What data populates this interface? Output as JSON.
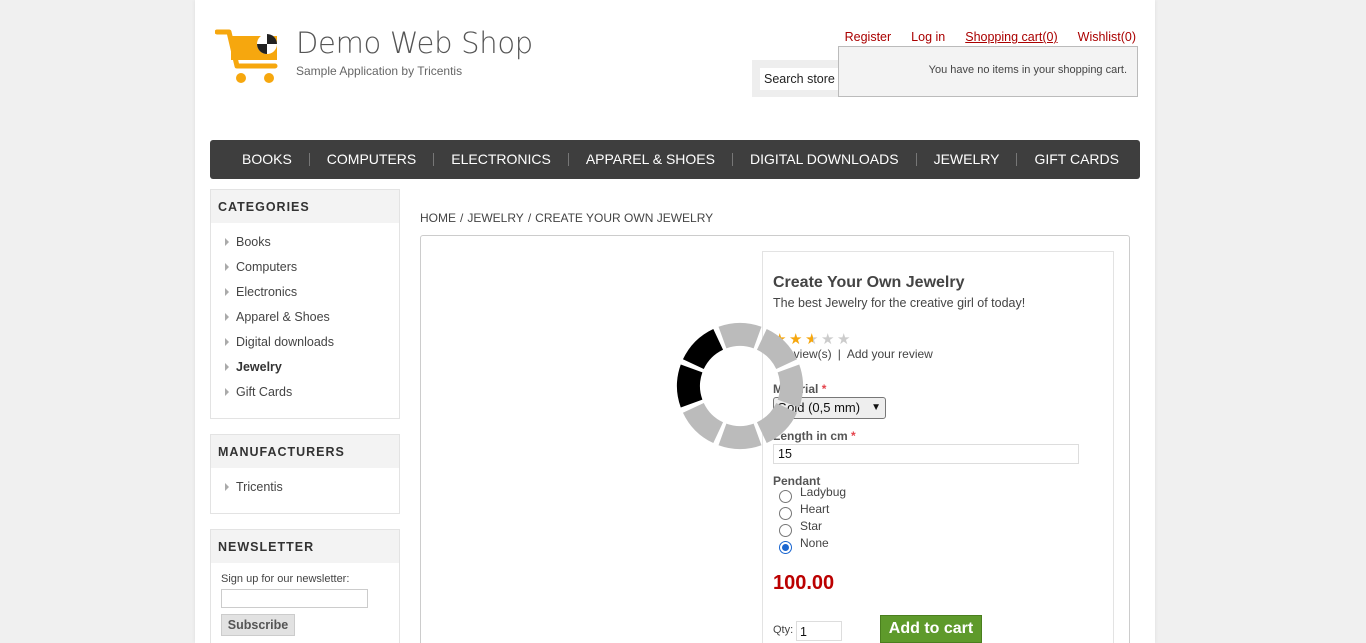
{
  "header": {
    "logo_title": "Demo Web Shop",
    "logo_subtitle": "Sample Application by Tricentis",
    "links": {
      "register": "Register",
      "login": "Log in",
      "cart": "Shopping cart",
      "cart_count": "(0)",
      "wishlist": "Wishlist",
      "wishlist_count": "(0)"
    },
    "search_placeholder": "Search store",
    "flyout_cart_text": "You have no items in your shopping cart."
  },
  "top_menu": [
    "BOOKS",
    "COMPUTERS",
    "ELECTRONICS",
    "APPAREL & SHOES",
    "DIGITAL DOWNLOADS",
    "JEWELRY",
    "GIFT CARDS"
  ],
  "sidebar": {
    "categories": {
      "title": "CATEGORIES",
      "items": [
        "Books",
        "Computers",
        "Electronics",
        "Apparel & Shoes",
        "Digital downloads",
        "Jewelry",
        "Gift Cards"
      ],
      "active": "Jewelry"
    },
    "manufacturers": {
      "title": "MANUFACTURERS",
      "items": [
        "Tricentis"
      ]
    },
    "newsletter": {
      "title": "NEWSLETTER",
      "label": "Sign up for our newsletter:",
      "button": "Subscribe"
    }
  },
  "breadcrumb": {
    "items": [
      "HOME",
      "JEWELRY",
      "CREATE YOUR OWN JEWELRY"
    ],
    "separator": "/"
  },
  "product": {
    "name": "Create Your Own Jewelry",
    "short_description": "The best Jewelry for the creative girl of today!",
    "rating_stars": 2.5,
    "rating_max": 5,
    "reviews_text": "1 review(s)",
    "add_review": "Add your review",
    "material_label": "Material",
    "material_value": "Gold (0,5 mm)",
    "length_label": "Length in cm",
    "length_value": "15",
    "pendant_label": "Pendant",
    "pendant_options": [
      "Ladybug",
      "Heart",
      "Star",
      "None"
    ],
    "pendant_selected": "None",
    "required_mark": "*",
    "price": "100.00",
    "qty_label": "Qty:",
    "qty_value": "1",
    "add_to_cart": "Add to cart"
  },
  "colors": {
    "link_red": "#aa0000",
    "menu_bg": "#3e3e3e",
    "price_red": "#bb0000",
    "button_green": "#5e9a2b",
    "logo_orange": "#f6a70e"
  }
}
